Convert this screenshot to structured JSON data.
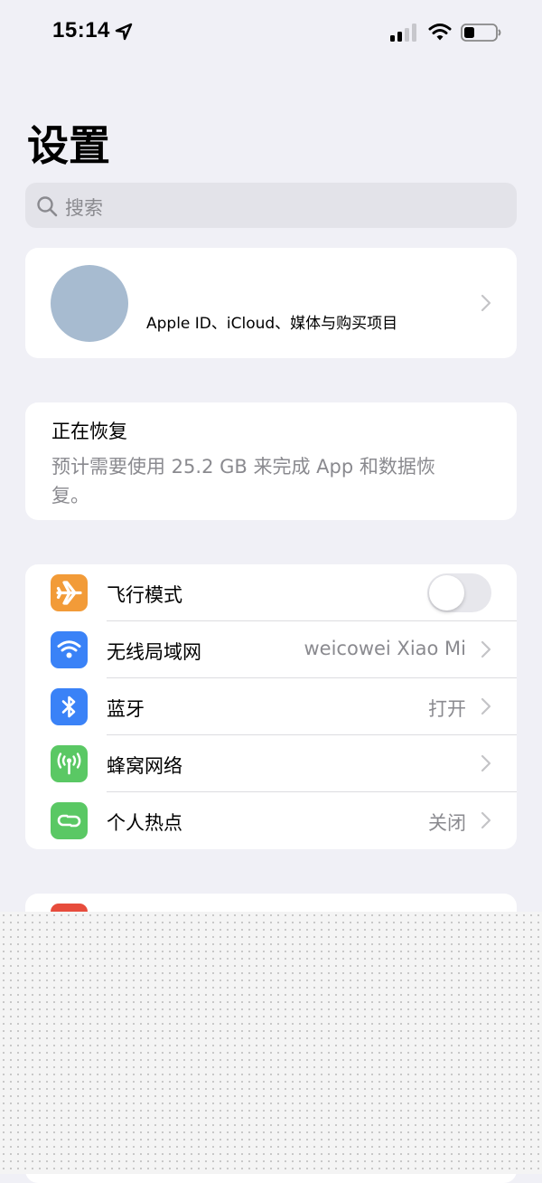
{
  "status_bar": {
    "time": "15:14",
    "icons": [
      "location-arrow-icon",
      "cellular-signal-icon",
      "wifi-icon",
      "battery-icon"
    ]
  },
  "page": {
    "title": "设置"
  },
  "search": {
    "placeholder": "搜索"
  },
  "profile": {
    "subtitle": "Apple ID、iCloud、媒体与购买项目"
  },
  "restore": {
    "title": "正在恢复",
    "description": "预计需要使用 25.2 GB 来完成 App 和数据恢复。"
  },
  "settings": {
    "items": [
      {
        "label": "飞行模式",
        "icon": "airplane-icon",
        "color": "#f29b38",
        "toggle": false
      },
      {
        "label": "无线局域网",
        "icon": "wifi-icon",
        "color": "#3a82f7",
        "value": "weicowei Xiao Mi"
      },
      {
        "label": "蓝牙",
        "icon": "bluetooth-icon",
        "color": "#3a82f7",
        "value": "打开"
      },
      {
        "label": "蜂窝网络",
        "icon": "cellular-antenna-icon",
        "color": "#5ac864",
        "value": ""
      },
      {
        "label": "个人热点",
        "icon": "hotspot-link-icon",
        "color": "#5ac864",
        "value": "关闭"
      }
    ]
  },
  "colors": {
    "background": "#f0f0f6",
    "secondary_text": "#8a8a8f",
    "avatar": "#a7bbd0"
  }
}
